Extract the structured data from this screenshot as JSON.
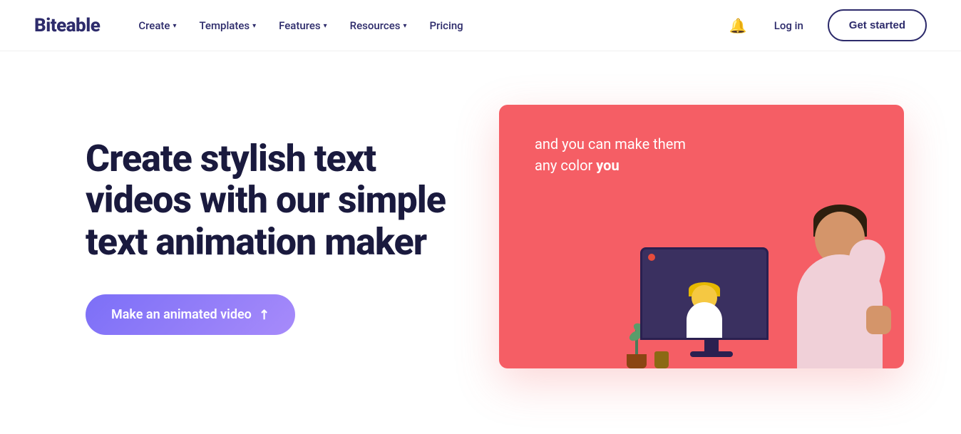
{
  "brand": {
    "name": "Biteable"
  },
  "nav": {
    "links": [
      {
        "label": "Create",
        "has_dropdown": true
      },
      {
        "label": "Templates",
        "has_dropdown": true
      },
      {
        "label": "Features",
        "has_dropdown": true
      },
      {
        "label": "Resources",
        "has_dropdown": true
      },
      {
        "label": "Pricing",
        "has_dropdown": false
      }
    ],
    "login_label": "Log in",
    "get_started_label": "Get started"
  },
  "hero": {
    "title": "Create stylish text videos with our simple text animation maker",
    "cta_label": "Make an animated video",
    "cta_arrow": "↗"
  },
  "panel": {
    "text_line1": "and you can make them",
    "text_line2_prefix": "any color ",
    "text_line2_highlight": "you"
  },
  "colors": {
    "brand_dark": "#2d2b6b",
    "cta_gradient_start": "#7c6ff7",
    "cta_gradient_end": "#a78bfa",
    "panel_bg": "#f55e65"
  }
}
